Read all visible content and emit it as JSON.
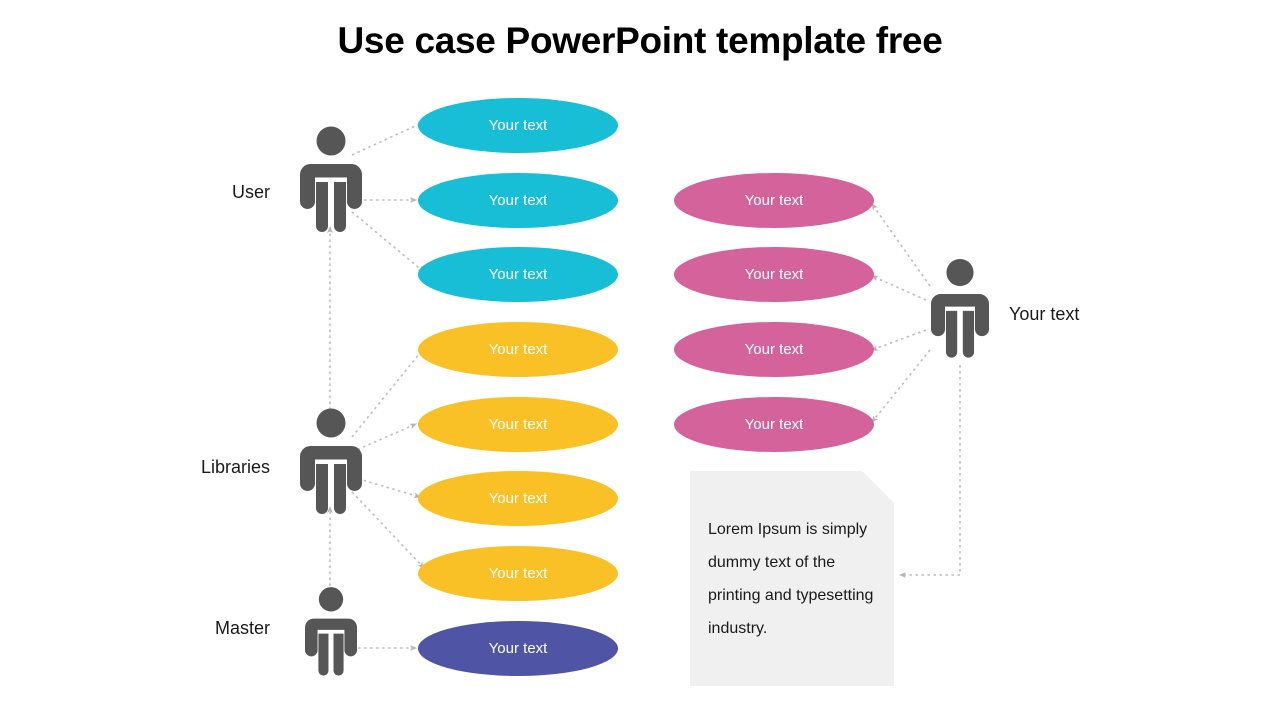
{
  "slide": {
    "title": "Use case PowerPoint template free",
    "background_color": "#FFFFFF"
  },
  "palette": {
    "cyan": "#17BED5",
    "yellow": "#FAC127",
    "pink": "#D4639C",
    "purple": "#4F54A4",
    "actor_gray": "#565656",
    "connector_gray": "#BDBDBD",
    "note_bg": "#F0F0F0",
    "text_dark": "#1A1A1A",
    "text_on_shape": "#FFFFFF"
  },
  "actors": {
    "left": [
      {
        "id": "user",
        "label": "User"
      },
      {
        "id": "libraries",
        "label": "Libraries"
      },
      {
        "id": "master",
        "label": "Master"
      }
    ],
    "right": [
      {
        "id": "right-actor",
        "label": "Your text"
      }
    ]
  },
  "use_cases": {
    "left_column": [
      {
        "id": "uc-1",
        "label": "Your text",
        "color": "#17BED5",
        "group": "cyan"
      },
      {
        "id": "uc-2",
        "label": "Your text",
        "color": "#17BED5",
        "group": "cyan"
      },
      {
        "id": "uc-3",
        "label": "Your text",
        "color": "#17BED5",
        "group": "cyan"
      },
      {
        "id": "uc-4",
        "label": "Your text",
        "color": "#FAC127",
        "group": "yellow"
      },
      {
        "id": "uc-5",
        "label": "Your text",
        "color": "#FAC127",
        "group": "yellow"
      },
      {
        "id": "uc-6",
        "label": "Your text",
        "color": "#FAC127",
        "group": "yellow"
      },
      {
        "id": "uc-7",
        "label": "Your text",
        "color": "#FAC127",
        "group": "yellow"
      },
      {
        "id": "uc-8",
        "label": "Your text",
        "color": "#4F54A4",
        "group": "purple"
      }
    ],
    "right_column": [
      {
        "id": "uc-r1",
        "label": "Your text",
        "color": "#D4639C",
        "group": "pink"
      },
      {
        "id": "uc-r2",
        "label": "Your text",
        "color": "#D4639C",
        "group": "pink"
      },
      {
        "id": "uc-r3",
        "label": "Your text",
        "color": "#D4639C",
        "group": "pink"
      },
      {
        "id": "uc-r4",
        "label": "Your text",
        "color": "#D4639C",
        "group": "pink"
      }
    ]
  },
  "note": {
    "text": "Lorem Ipsum is simply dummy text of the printing and typesetting industry."
  },
  "icons": {
    "actor": "person-icon"
  }
}
